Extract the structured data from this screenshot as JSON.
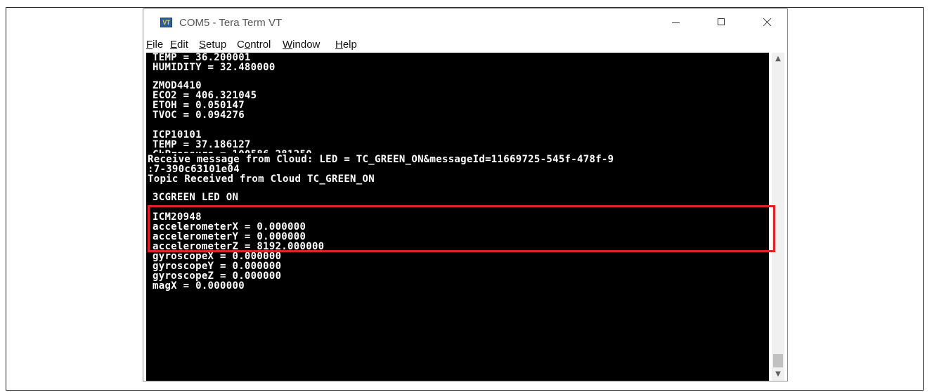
{
  "window": {
    "title": "COM5 - Tera Term VT",
    "icon_label": "VT",
    "controls": {
      "minimize": "minimize-icon",
      "maximize": "maximize-icon",
      "close": "close-icon"
    }
  },
  "menu": [
    "File",
    "Edit",
    "Setup",
    "Control",
    "Window",
    "Help"
  ],
  "terminal_lines": [
    "TEMP = 36.200001",
    "HUMIDITY = 32.480000",
    "ZMOD4410",
    "ECO2 = 406.321045",
    "ETOH = 0.050147",
    "TVOC = 0.094276",
    "ICP10101",
    "TEMP = 37.186127",
    "CkPressure = 100586.281250",
    "Receive message from Cloud: LED = TC_GREEN_ON&messageId=11669725-545f-478f-9",
    ":7-390c63101e04",
    "Topic Received from Cloud TC_GREEN_ON",
    "3CGREEN LED ON",
    "ICM20948",
    "accelerometerX = 0.000000",
    "accelerometerY = 0.000000",
    "accelerometerZ = 8192.000000",
    "gyroscopeX = 0.000000",
    "gyroscopeY = 0.000000",
    "gyroscopeZ = 0.000000",
    "magX = 0.000000"
  ],
  "highlight_color": "#e0202a",
  "scrollbar": {
    "up": "▲",
    "down": "▼"
  }
}
